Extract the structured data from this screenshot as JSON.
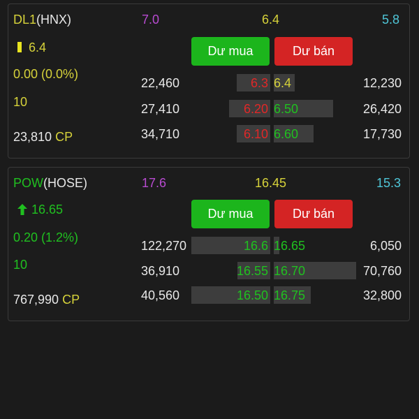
{
  "colors": {
    "yellow": "#d6d23a",
    "green": "#20c020",
    "red": "#e02828",
    "purple": "#b84bd1",
    "cyan": "#4fc6d8",
    "white": "#e8e8e8",
    "buy_button": "#1cb51c",
    "sell_button": "#d42424",
    "bar": "#3d3d3d"
  },
  "stocks": [
    {
      "symbol": "DL1",
      "exchange": "(HNX)",
      "price": "6.4",
      "price_icon": "reference-bar-icon",
      "change": "0.00 (0.0%)",
      "volume_lot": "10",
      "total_volume": "23,810",
      "total_unit": "CP",
      "ceiling": "7.0",
      "reference": "6.4",
      "floor": "5.8",
      "buy_label": "Dư mua",
      "sell_label": "Dư bán",
      "rows": [
        {
          "bid_vol": "22,460",
          "bid_price": "6.3",
          "ask_price": "6.4",
          "ask_vol": "12,230",
          "bid_color": "red",
          "ask_color": "yellow"
        },
        {
          "bid_vol": "27,410",
          "bid_price": "6.20",
          "ask_price": "6.50",
          "ask_vol": "26,420",
          "bid_color": "red",
          "ask_color": "green"
        },
        {
          "bid_vol": "34,710",
          "bid_price": "6.10",
          "ask_price": "6.60",
          "ask_vol": "17,730",
          "bid_color": "red",
          "ask_color": "green"
        }
      ]
    },
    {
      "symbol": "POW",
      "exchange": "(HOSE)",
      "price": "16.65",
      "price_icon": "arrow-up-icon",
      "change": "0.20 (1.2%)",
      "volume_lot": "10",
      "total_volume": "767,990",
      "total_unit": "CP",
      "ceiling": "17.6",
      "reference": "16.45",
      "floor": "15.3",
      "buy_label": "Dư mua",
      "sell_label": "Dư bán",
      "rows": [
        {
          "bid_vol": "122,270",
          "bid_price": "16.6",
          "ask_price": "16.65",
          "ask_vol": "6,050",
          "bid_color": "green",
          "ask_color": "green"
        },
        {
          "bid_vol": "36,910",
          "bid_price": "16.55",
          "ask_price": "16.70",
          "ask_vol": "70,760",
          "bid_color": "green",
          "ask_color": "green"
        },
        {
          "bid_vol": "40,560",
          "bid_price": "16.50",
          "ask_price": "16.75",
          "ask_vol": "32,800",
          "bid_color": "green",
          "ask_color": "green"
        }
      ]
    }
  ]
}
